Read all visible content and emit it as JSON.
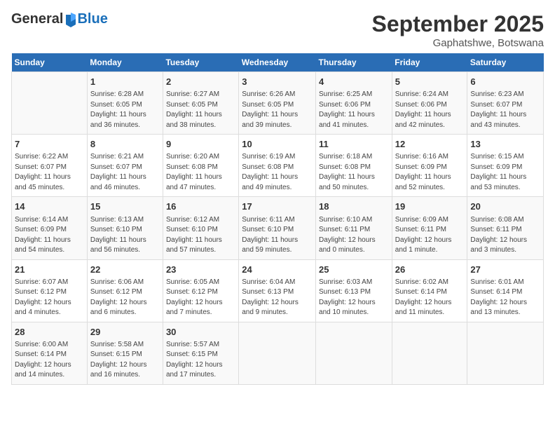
{
  "header": {
    "logo_general": "General",
    "logo_blue": "Blue",
    "month": "September 2025",
    "location": "Gaphatshwe, Botswana"
  },
  "days_of_week": [
    "Sunday",
    "Monday",
    "Tuesday",
    "Wednesday",
    "Thursday",
    "Friday",
    "Saturday"
  ],
  "weeks": [
    [
      {
        "day": "",
        "content": ""
      },
      {
        "day": "1",
        "content": "Sunrise: 6:28 AM\nSunset: 6:05 PM\nDaylight: 11 hours\nand 36 minutes."
      },
      {
        "day": "2",
        "content": "Sunrise: 6:27 AM\nSunset: 6:05 PM\nDaylight: 11 hours\nand 38 minutes."
      },
      {
        "day": "3",
        "content": "Sunrise: 6:26 AM\nSunset: 6:05 PM\nDaylight: 11 hours\nand 39 minutes."
      },
      {
        "day": "4",
        "content": "Sunrise: 6:25 AM\nSunset: 6:06 PM\nDaylight: 11 hours\nand 41 minutes."
      },
      {
        "day": "5",
        "content": "Sunrise: 6:24 AM\nSunset: 6:06 PM\nDaylight: 11 hours\nand 42 minutes."
      },
      {
        "day": "6",
        "content": "Sunrise: 6:23 AM\nSunset: 6:07 PM\nDaylight: 11 hours\nand 43 minutes."
      }
    ],
    [
      {
        "day": "7",
        "content": "Sunrise: 6:22 AM\nSunset: 6:07 PM\nDaylight: 11 hours\nand 45 minutes."
      },
      {
        "day": "8",
        "content": "Sunrise: 6:21 AM\nSunset: 6:07 PM\nDaylight: 11 hours\nand 46 minutes."
      },
      {
        "day": "9",
        "content": "Sunrise: 6:20 AM\nSunset: 6:08 PM\nDaylight: 11 hours\nand 47 minutes."
      },
      {
        "day": "10",
        "content": "Sunrise: 6:19 AM\nSunset: 6:08 PM\nDaylight: 11 hours\nand 49 minutes."
      },
      {
        "day": "11",
        "content": "Sunrise: 6:18 AM\nSunset: 6:08 PM\nDaylight: 11 hours\nand 50 minutes."
      },
      {
        "day": "12",
        "content": "Sunrise: 6:16 AM\nSunset: 6:09 PM\nDaylight: 11 hours\nand 52 minutes."
      },
      {
        "day": "13",
        "content": "Sunrise: 6:15 AM\nSunset: 6:09 PM\nDaylight: 11 hours\nand 53 minutes."
      }
    ],
    [
      {
        "day": "14",
        "content": "Sunrise: 6:14 AM\nSunset: 6:09 PM\nDaylight: 11 hours\nand 54 minutes."
      },
      {
        "day": "15",
        "content": "Sunrise: 6:13 AM\nSunset: 6:10 PM\nDaylight: 11 hours\nand 56 minutes."
      },
      {
        "day": "16",
        "content": "Sunrise: 6:12 AM\nSunset: 6:10 PM\nDaylight: 11 hours\nand 57 minutes."
      },
      {
        "day": "17",
        "content": "Sunrise: 6:11 AM\nSunset: 6:10 PM\nDaylight: 11 hours\nand 59 minutes."
      },
      {
        "day": "18",
        "content": "Sunrise: 6:10 AM\nSunset: 6:11 PM\nDaylight: 12 hours\nand 0 minutes."
      },
      {
        "day": "19",
        "content": "Sunrise: 6:09 AM\nSunset: 6:11 PM\nDaylight: 12 hours\nand 1 minute."
      },
      {
        "day": "20",
        "content": "Sunrise: 6:08 AM\nSunset: 6:11 PM\nDaylight: 12 hours\nand 3 minutes."
      }
    ],
    [
      {
        "day": "21",
        "content": "Sunrise: 6:07 AM\nSunset: 6:12 PM\nDaylight: 12 hours\nand 4 minutes."
      },
      {
        "day": "22",
        "content": "Sunrise: 6:06 AM\nSunset: 6:12 PM\nDaylight: 12 hours\nand 6 minutes."
      },
      {
        "day": "23",
        "content": "Sunrise: 6:05 AM\nSunset: 6:12 PM\nDaylight: 12 hours\nand 7 minutes."
      },
      {
        "day": "24",
        "content": "Sunrise: 6:04 AM\nSunset: 6:13 PM\nDaylight: 12 hours\nand 9 minutes."
      },
      {
        "day": "25",
        "content": "Sunrise: 6:03 AM\nSunset: 6:13 PM\nDaylight: 12 hours\nand 10 minutes."
      },
      {
        "day": "26",
        "content": "Sunrise: 6:02 AM\nSunset: 6:14 PM\nDaylight: 12 hours\nand 11 minutes."
      },
      {
        "day": "27",
        "content": "Sunrise: 6:01 AM\nSunset: 6:14 PM\nDaylight: 12 hours\nand 13 minutes."
      }
    ],
    [
      {
        "day": "28",
        "content": "Sunrise: 6:00 AM\nSunset: 6:14 PM\nDaylight: 12 hours\nand 14 minutes."
      },
      {
        "day": "29",
        "content": "Sunrise: 5:58 AM\nSunset: 6:15 PM\nDaylight: 12 hours\nand 16 minutes."
      },
      {
        "day": "30",
        "content": "Sunrise: 5:57 AM\nSunset: 6:15 PM\nDaylight: 12 hours\nand 17 minutes."
      },
      {
        "day": "",
        "content": ""
      },
      {
        "day": "",
        "content": ""
      },
      {
        "day": "",
        "content": ""
      },
      {
        "day": "",
        "content": ""
      }
    ]
  ]
}
